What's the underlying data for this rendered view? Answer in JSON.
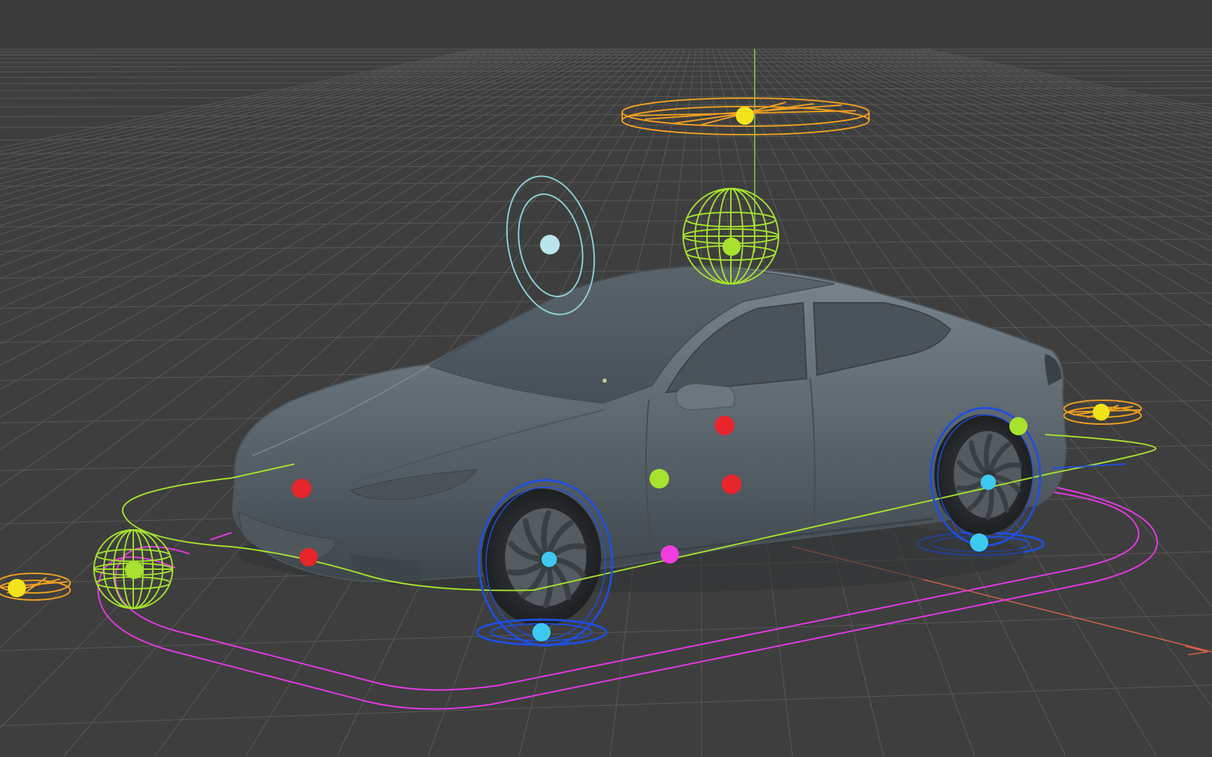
{
  "viewport": {
    "background_color": "#3c3c3c",
    "top_band_color": "#3a3a3a",
    "floor_color": "#3e3e3e",
    "grid_color": "#5a5a5a",
    "model": "car",
    "model_color": "#5f6a72"
  },
  "colors": {
    "x_axis": "#d9604c",
    "y_axis": "#8fd14f",
    "body_controls": "#a6e22e",
    "wheel_controls": "#1f4fe0",
    "wheel_pivot": "#3ec9f0",
    "path_magenta": "#e63ae6",
    "corner_targets": "#f0a020",
    "target_point": "#f2e31a",
    "aim_ring": "#8fd3d8",
    "red_handles": "#e8252a",
    "magenta_handle": "#f03ce0"
  },
  "controls": [
    {
      "name": "top-target-disc-icon",
      "color_key": "corner_targets",
      "interactable": true
    },
    {
      "name": "roof-sphere-control",
      "color_key": "body_controls",
      "interactable": true
    },
    {
      "name": "aim-ring-control",
      "color_key": "aim_ring",
      "interactable": true
    },
    {
      "name": "front-sphere-control",
      "color_key": "body_controls",
      "interactable": true
    },
    {
      "name": "left-corner-target-disc",
      "color_key": "corner_targets",
      "interactable": true
    },
    {
      "name": "right-corner-target-disc",
      "color_key": "corner_targets",
      "interactable": true
    },
    {
      "name": "front-wheel-control",
      "color_key": "wheel_controls",
      "interactable": true
    },
    {
      "name": "rear-wheel-control",
      "color_key": "wheel_controls",
      "interactable": true
    },
    {
      "name": "body-path-curve",
      "color_key": "body_controls",
      "interactable": true
    },
    {
      "name": "ground-path-curve",
      "color_key": "path_magenta",
      "interactable": true
    }
  ]
}
